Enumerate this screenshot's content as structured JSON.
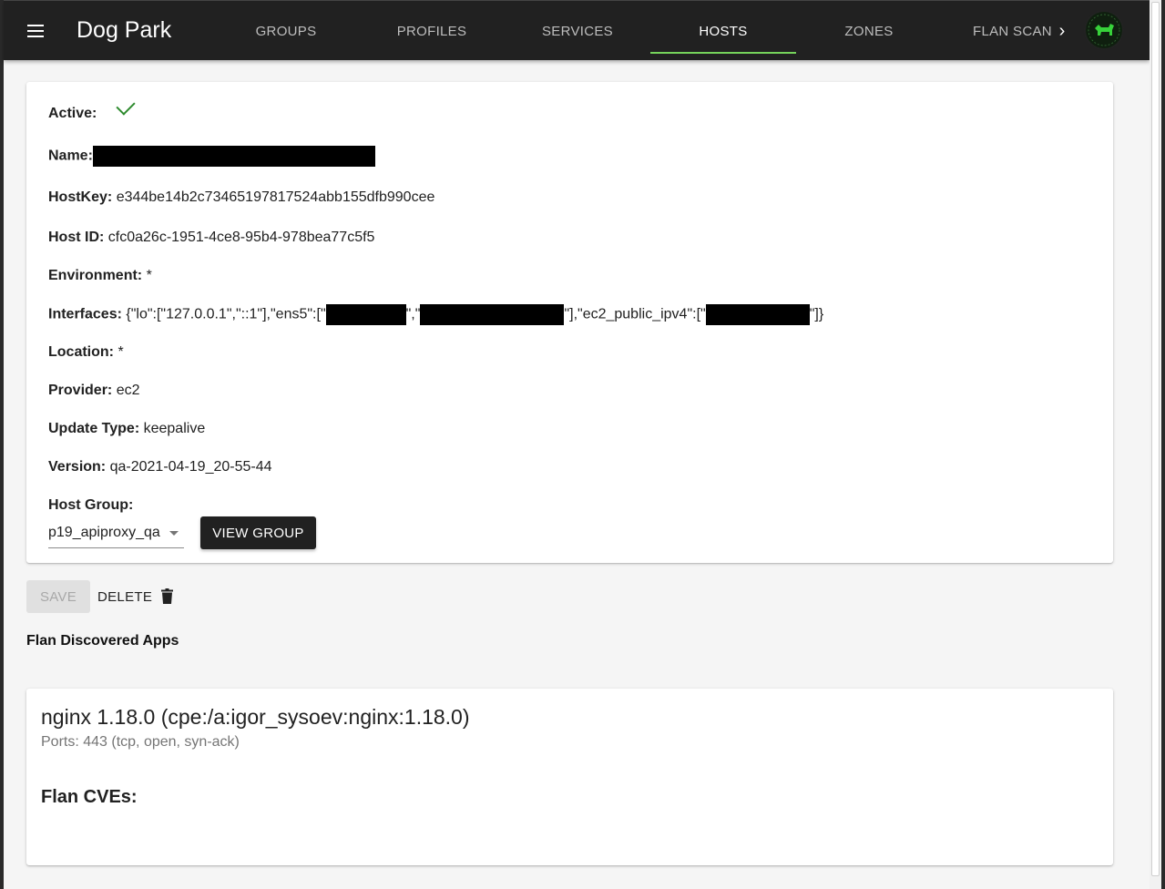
{
  "app": {
    "title": "Dog Park",
    "avatar_label": "dog"
  },
  "nav": {
    "tabs": [
      {
        "label": "GROUPS"
      },
      {
        "label": "PROFILES"
      },
      {
        "label": "SERVICES"
      },
      {
        "label": "HOSTS",
        "active": true
      },
      {
        "label": "ZONES"
      },
      {
        "label": "FLAN SCAN"
      }
    ],
    "next_icon": "chevron-right-icon"
  },
  "host": {
    "active_label": "Active:",
    "active_value": "check-icon",
    "name_label": "Name:",
    "name_value": "[redacted]",
    "hostkey_label": "HostKey:",
    "hostkey_value": "e344be14b2c73465197817524abb155dfb990cee",
    "hostid_label": "Host ID:",
    "hostid_value": "cfc0a26c-1951-4ce8-95b4-978bea77c5f5",
    "environment_label": "Environment:",
    "environment_value": "*",
    "interfaces_label": "Interfaces:",
    "interfaces_part1": "{\"lo\":[\"127.0.0.1\",\"::1\"],\"ens5\":[\"",
    "interfaces_sep": "\",\"",
    "interfaces_part2": "\"],\"ec2_public_ipv4\":[\"",
    "interfaces_part3": "\"]}",
    "location_label": "Location:",
    "location_value": "*",
    "provider_label": "Provider:",
    "provider_value": "ec2",
    "update_type_label": "Update Type:",
    "update_type_value": "keepalive",
    "version_label": "Version:",
    "version_value": "qa-2021-04-19_20-55-44",
    "host_group_label": "Host Group:",
    "host_group_value": "p19_apiproxy_qa",
    "view_group_label": "VIEW GROUP"
  },
  "actions": {
    "save_label": "SAVE",
    "delete_label": "DELETE"
  },
  "flan": {
    "section_title": "Flan Discovered Apps",
    "apps": [
      {
        "name": "nginx 1.18.0 (cpe:/a:igor_sysoev:nginx:1.18.0)",
        "ports": "Ports: 443 (tcp, open, syn-ack)",
        "cves_title": "Flan CVEs:"
      }
    ]
  },
  "colors": {
    "appbar": "#212121",
    "tab_indicator": "#76d35b",
    "check": "#2e8b2e",
    "primary_button": "#212121"
  }
}
